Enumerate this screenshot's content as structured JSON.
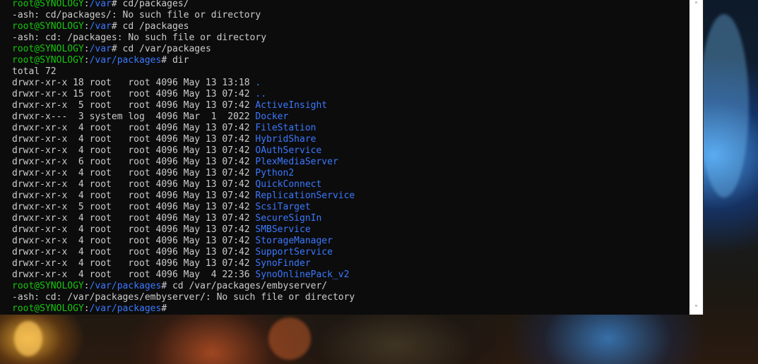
{
  "terminal": {
    "lines": [
      {
        "prompt_user": "root@SYNOLOGY",
        "prompt_sep": ":",
        "prompt_path": "/var",
        "prompt_end": "# ",
        "command": "cd/packages/"
      },
      {
        "output": "-ash: cd/packages/: No such file or directory"
      },
      {
        "prompt_user": "root@SYNOLOGY",
        "prompt_sep": ":",
        "prompt_path": "/var",
        "prompt_end": "# ",
        "command": "cd /packages"
      },
      {
        "output": "-ash: cd: /packages: No such file or directory"
      },
      {
        "prompt_user": "root@SYNOLOGY",
        "prompt_sep": ":",
        "prompt_path": "/var",
        "prompt_end": "# ",
        "command": "cd /var/packages"
      },
      {
        "prompt_user": "root@SYNOLOGY",
        "prompt_sep": ":",
        "prompt_path": "/var/packages",
        "prompt_end": "# ",
        "command": "dir"
      },
      {
        "output": "total 72"
      }
    ],
    "listing": [
      {
        "meta": "drwxr-xr-x 18 root   root 4096 May 13 13:18 ",
        "name": "."
      },
      {
        "meta": "drwxr-xr-x 15 root   root 4096 May 13 07:42 ",
        "name": ".."
      },
      {
        "meta": "drwxr-xr-x  5 root   root 4096 May 13 07:42 ",
        "name": "ActiveInsight"
      },
      {
        "meta": "drwxr-x---  3 system log  4096 Mar  1  2022 ",
        "name": "Docker"
      },
      {
        "meta": "drwxr-xr-x  4 root   root 4096 May 13 07:42 ",
        "name": "FileStation"
      },
      {
        "meta": "drwxr-xr-x  4 root   root 4096 May 13 07:42 ",
        "name": "HybridShare"
      },
      {
        "meta": "drwxr-xr-x  4 root   root 4096 May 13 07:42 ",
        "name": "OAuthService"
      },
      {
        "meta": "drwxr-xr-x  6 root   root 4096 May 13 07:42 ",
        "name": "PlexMediaServer"
      },
      {
        "meta": "drwxr-xr-x  4 root   root 4096 May 13 07:42 ",
        "name": "Python2"
      },
      {
        "meta": "drwxr-xr-x  4 root   root 4096 May 13 07:42 ",
        "name": "QuickConnect"
      },
      {
        "meta": "drwxr-xr-x  4 root   root 4096 May 13 07:42 ",
        "name": "ReplicationService"
      },
      {
        "meta": "drwxr-xr-x  5 root   root 4096 May 13 07:42 ",
        "name": "ScsiTarget"
      },
      {
        "meta": "drwxr-xr-x  4 root   root 4096 May 13 07:42 ",
        "name": "SecureSignIn"
      },
      {
        "meta": "drwxr-xr-x  4 root   root 4096 May 13 07:42 ",
        "name": "SMBService"
      },
      {
        "meta": "drwxr-xr-x  4 root   root 4096 May 13 07:42 ",
        "name": "StorageManager"
      },
      {
        "meta": "drwxr-xr-x  4 root   root 4096 May 13 07:42 ",
        "name": "SupportService"
      },
      {
        "meta": "drwxr-xr-x  4 root   root 4096 May 13 07:42 ",
        "name": "SynoFinder"
      },
      {
        "meta": "drwxr-xr-x  4 root   root 4096 May  4 22:36 ",
        "name": "SynoOnlinePack_v2"
      }
    ],
    "tail": [
      {
        "prompt_user": "root@SYNOLOGY",
        "prompt_sep": ":",
        "prompt_path": "/var/packages",
        "prompt_end": "# ",
        "command": "cd /var/packages/embyserver/"
      },
      {
        "output": "-ash: cd: /var/packages/embyserver/: No such file or directory"
      },
      {
        "prompt_user": "root@SYNOLOGY",
        "prompt_sep": ":",
        "prompt_path": "/var/packages",
        "prompt_end": "#",
        "command": ""
      }
    ]
  },
  "scrollbar": {
    "up_glyph": "˄",
    "down_glyph": "˅"
  },
  "colors": {
    "terminal_bg": "#0c0c0c",
    "text": "#cccccc",
    "prompt_user": "#16c60c",
    "prompt_path": "#3b78ff",
    "directory": "#3b78ff"
  }
}
